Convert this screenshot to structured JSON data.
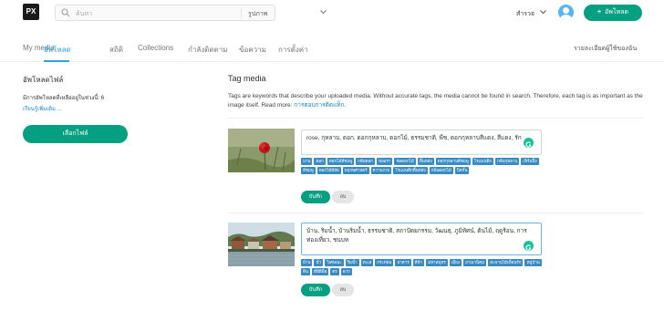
{
  "header": {
    "logo": "PX",
    "search_placeholder": "ค้นหา",
    "search_type": "รูปภาพ",
    "explore_label": "สำรวจ",
    "upload_label": "อัพโหลด",
    "upload_plus": "+"
  },
  "tabs": [
    {
      "label": "My media"
    },
    {
      "label": "อัพโหลด",
      "active": true
    },
    {
      "label": "สถิติ"
    },
    {
      "label": "Collections"
    },
    {
      "label": "กำลังติดตาม"
    },
    {
      "label": "ข้อความ"
    },
    {
      "label": "การตั้งค่า"
    }
  ],
  "tab_right": "รายละเอียดผู้ใช้ของฉัน",
  "left_panel": {
    "title": "อัพโหลดไฟล์",
    "remaining": "มีการอัพโหลดที่เหลืออยู่ในช่วงนี้: 6",
    "more_link": "เรียนรู้เพิ่มเติม ...",
    "choose_button": "เลือกไฟล์"
  },
  "right_panel": {
    "title": "Tag media",
    "description": "Tags are keywords that describe your uploaded media. Without accurate tags, the media cannot be found in search. Therefore, each tag is as important as the image itself. Read more:",
    "description_link": "การตอบการติดแท็ก."
  },
  "media": [
    {
      "tags_text": "rose, กุหลาบ, ดอก, ดอกกุหลาบ, ดอกไม้, ธรรมชาติ, พืช, ดอกกุหลาบสีแดง, สีแดง, รัก",
      "chips": [
        "บาน",
        "ดอก",
        "ดอกไม้สีชมพู",
        "กลีบดอก",
        "ฟลอรา",
        "ช่อดอกไม้",
        "พื้นหลัง",
        "ดอกกุหลาบสีชมพู",
        "โรแมนติก",
        "กลีบกุหลาบ",
        "เฟิร์นปิ้ง",
        "สีชมพู",
        "ดอกไม้มีสัย",
        "พฤกษศาสตร์",
        "ความงาม",
        "โรแมนติกพื้นหลัง",
        "กลิ่นดอกไม้",
        "ปิดกั้น"
      ],
      "save": "บันทึก",
      "delete": "ลบ"
    },
    {
      "tags_text": "บ้าน, ริมน้ำ, บ้านริมน้ำ, ธรรมชาติ, สถาปัตยกรรม, วัฒนธุ, ภูมิทัศน์, ต้นไม้, ฤดูร้อน, การท่องเที่ยว, ชนบท",
      "chips": [
        "บ้าน",
        "น้ำ",
        "วิเศษณะ",
        "ริมน้ำ",
        "ทะเล",
        "กระท่อม",
        "อาคาร",
        "สีฟ้า",
        "มหาสมุทร",
        "เมือง",
        "อาณานิคม",
        "สะพานไม้เพื่อนรัก",
        "หมู่บ้าน",
        "ดิน",
        "ที่มีฝีมือ",
        "ตร",
        "ฉาก"
      ],
      "save": "บันทึก",
      "delete": "ลบ"
    }
  ]
}
